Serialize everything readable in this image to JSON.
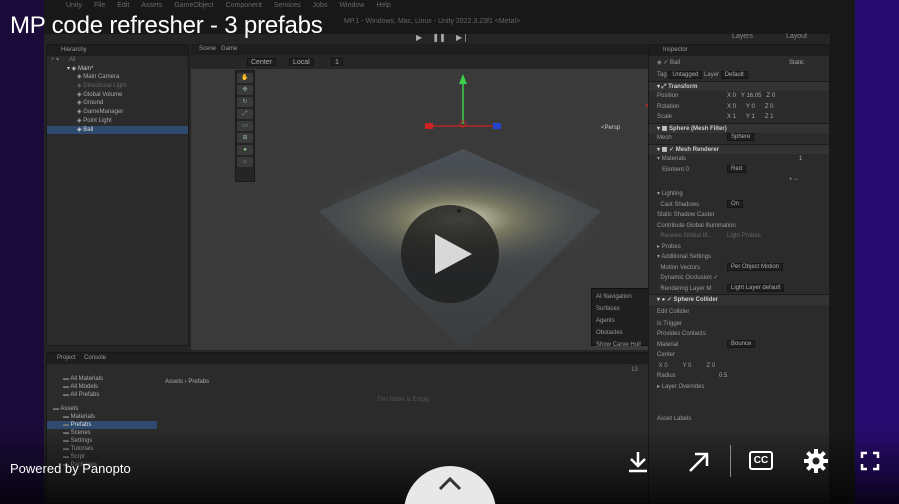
{
  "video": {
    "title": "MP code refresher - 3 prefabs",
    "powered_by": "Powered by Panopto",
    "controls": {
      "play": "play-icon",
      "download": "download-icon",
      "share": "share-arrow-icon",
      "captions": "CC",
      "settings": "gear-icon",
      "fullscreen": "fullscreen-icon",
      "expand": "chevron-up-icon"
    }
  },
  "unity": {
    "menu": [
      "Unity",
      "File",
      "Edit",
      "Assets",
      "GameObject",
      "Component",
      "Services",
      "Jobs",
      "Window",
      "Help"
    ],
    "window_title": "MP.1 - Windows, Mac, Linux - Unity 2022.3.23f1 <Metal>",
    "layers": "Layers",
    "layout": "Layout",
    "hierarchy": {
      "tab": "Hierarchy",
      "search": "All",
      "root": "Main*",
      "items": [
        {
          "label": "Main Camera",
          "dim": false,
          "selected": false
        },
        {
          "label": "Directional Light",
          "dim": true,
          "selected": false
        },
        {
          "label": "Global Volume",
          "dim": false,
          "selected": false
        },
        {
          "label": "Ground",
          "dim": false,
          "selected": false
        },
        {
          "label": "GameManager",
          "dim": false,
          "selected": false
        },
        {
          "label": "Point Light",
          "dim": false,
          "selected": false
        },
        {
          "label": "Ball",
          "dim": false,
          "selected": true
        }
      ]
    },
    "scene": {
      "tabs": [
        "Scene",
        "Game"
      ],
      "pivot": "Center",
      "space": "Local",
      "grid": "1",
      "persp": "<Persp",
      "ai_nav": {
        "title": "AI Navigation",
        "items": [
          "Surfaces",
          "Agents",
          "Obstacles",
          "Show Carve Hull"
        ]
      }
    },
    "project": {
      "tabs": [
        "Project",
        "Console"
      ],
      "favorites": [
        "All Materials",
        "All Models",
        "All Prefabs"
      ],
      "assets_root": "Assets",
      "assets": [
        "Materials",
        "Prefabs",
        "Scenes",
        "Settings",
        "Tutorials",
        "Scrpt",
        "Packages"
      ],
      "selected_folder": "Prefabs",
      "breadcrumb": [
        "Assets",
        "Prefabs"
      ],
      "empty_msg": "This folder is Empty",
      "count": "13"
    },
    "inspector": {
      "tab": "Inspector",
      "object_name": "Ball",
      "static": "Static",
      "tag": "Untagged",
      "layer": "Default",
      "transform": {
        "title": "Transform",
        "position": {
          "x": "0",
          "y": "16.05",
          "z": "0"
        },
        "rotation": {
          "x": "0",
          "y": "0",
          "z": "0"
        },
        "scale": {
          "x": "1",
          "y": "1",
          "z": "1"
        }
      },
      "mesh_filter": {
        "title": "Sphere (Mesh Filter)",
        "mesh": "Sphere"
      },
      "mesh_renderer": {
        "title": "Mesh Renderer",
        "materials_count": "1",
        "element0": "Red",
        "lighting": "Lighting",
        "cast_shadows": "On",
        "static_shadow": "Static Shadow Caster",
        "contribute_gi": "Contribute Global Illumination",
        "receive_gi": "Light Probes",
        "probes": "Probes",
        "additional": "Additional Settings",
        "motion_vectors": "Per Object Motion",
        "dynamic_occlusion": "Dynamic Occlusion",
        "rendering_layer": "Light Layer default"
      },
      "sphere_collider": {
        "title": "Sphere Collider",
        "edit": "Edit Collider",
        "is_trigger": "Is Trigger",
        "contacts": "Provides Contacts",
        "material": "Bounce",
        "center": {
          "x": "0",
          "y": "0",
          "z": "0"
        },
        "radius": "0.5",
        "layer_overrides": "Layer Overrides"
      },
      "asset_labels": "Asset Labels"
    }
  }
}
